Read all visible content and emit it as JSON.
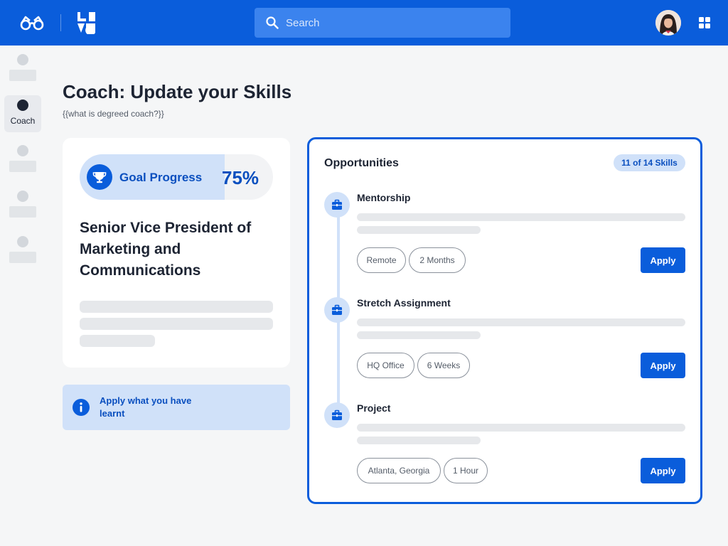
{
  "header": {
    "search_placeholder": "Search",
    "logo_icon": "glasses-logo-icon",
    "brand_icon": "brand-mark-icon",
    "apps_icon": "apps-grid-icon"
  },
  "sidebar": {
    "active_label": "Coach"
  },
  "page": {
    "title": "Coach: Update your Skills",
    "subtitle": "{{what is degreed coach?}}"
  },
  "goal": {
    "label": "Goal Progress",
    "percent_text": "75%",
    "progress": 0.75,
    "role": "Senior Vice President of Marketing and Communications"
  },
  "info": {
    "text": "Apply what you have learnt"
  },
  "opportunities": {
    "title": "Opportunities",
    "badge": "11 of 14 Skills",
    "items": [
      {
        "name": "Mentorship",
        "tags": [
          "Remote",
          "2 Months"
        ],
        "apply_label": "Apply"
      },
      {
        "name": "Stretch Assignment",
        "tags": [
          "HQ Office",
          "6 Weeks"
        ],
        "apply_label": "Apply"
      },
      {
        "name": "Project",
        "tags": [
          "Atlanta, Georgia",
          "1 Hour"
        ],
        "apply_label": "Apply"
      }
    ]
  },
  "colors": {
    "brand_blue": "#0a5ddb",
    "light_blue": "#d0e1f9",
    "text_dark": "#1d2433"
  }
}
